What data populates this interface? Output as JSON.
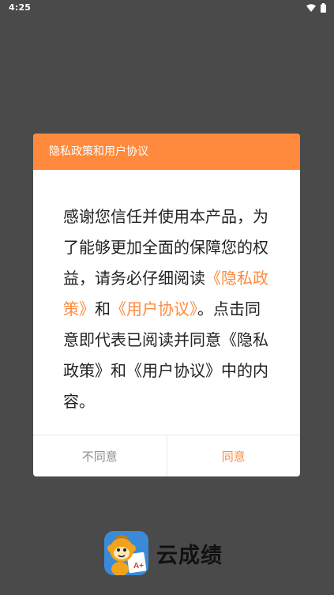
{
  "status_bar": {
    "time": "4:25"
  },
  "dialog": {
    "title": "隐私政策和用户协议",
    "body": {
      "part1": "感谢您信任并使用本产品，为了能够更加全面的保障您的权益，请务必仔细阅读",
      "privacy_link": "《隐私政策》",
      "and": "和",
      "agreement_link": "《用户协议》",
      "part2": "。点击同意即代表已阅读并同意《隐私政策》和《用户协议》中的内容。"
    },
    "buttons": {
      "disagree": "不同意",
      "agree": "同意"
    }
  },
  "brand": {
    "app_name": "云成绩",
    "logo_icon": "monkey-logo-icon",
    "logo_badge": "A+"
  },
  "colors": {
    "accent": "#ff8a3d",
    "overlay": "#4a4a4a",
    "logo_bg": "#3a8ad8"
  }
}
